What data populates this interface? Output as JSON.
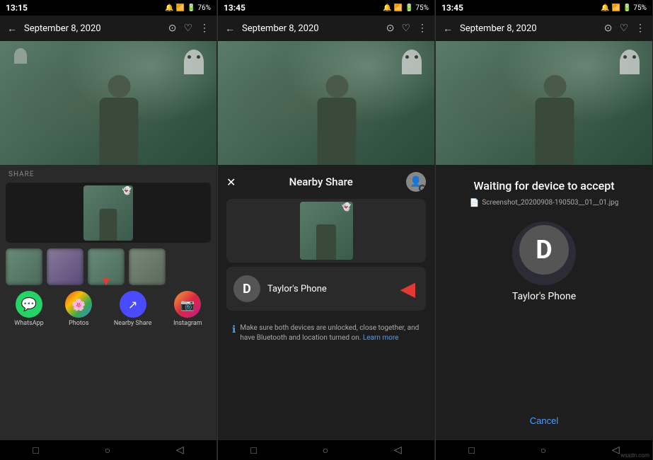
{
  "panels": [
    {
      "id": "panel1",
      "status_bar": {
        "time": "13:15",
        "icons": "🔔📶🔋76%"
      },
      "top_bar": {
        "back": "←",
        "title": "September 8, 2020",
        "icons": [
          "⊙",
          "♡",
          "⋮"
        ]
      },
      "share": {
        "label": "SHARE",
        "apps": [
          {
            "name": "WhatsApp",
            "icon": "💬",
            "bg": "whatsapp"
          },
          {
            "name": "Photos",
            "icon": "🖼",
            "bg": "photos"
          },
          {
            "name": "Nearby Share",
            "icon": "↗",
            "bg": "nearby"
          },
          {
            "name": "Instagram",
            "icon": "📷",
            "bg": "instagram"
          }
        ]
      },
      "nav": [
        "□",
        "○",
        "◁"
      ]
    },
    {
      "id": "panel2",
      "status_bar": {
        "time": "13:45",
        "icons": "🔔📶🔋75%"
      },
      "top_bar": {
        "back": "←",
        "title": "September 8, 2020",
        "icons": [
          "⊙",
          "♡",
          "⋮"
        ]
      },
      "nearby_share": {
        "close": "✕",
        "title": "Nearby Share",
        "device": {
          "avatar_letter": "D",
          "name": "Taylor's Phone"
        },
        "info_text": "Make sure both devices are unlocked, close together, and have Bluetooth and location turned on.",
        "info_link": "Learn more"
      },
      "nav": [
        "□",
        "○",
        "◁"
      ]
    },
    {
      "id": "panel3",
      "status_bar": {
        "time": "13:45",
        "icons": "🔔📶🔋75%"
      },
      "top_bar": {
        "back": "←",
        "title": "September 8, 2020",
        "icons": [
          "⊙",
          "♡",
          "⋮"
        ]
      },
      "waiting": {
        "title": "Waiting for device to accept",
        "filename": "Screenshot_20200908-190503__01__01.jpg",
        "device_letter": "D",
        "device_name": "Taylor's Phone",
        "cancel_label": "Cancel"
      },
      "nav": [
        "□",
        "○",
        "◁"
      ]
    }
  ],
  "watermark": "wsxdn.com"
}
